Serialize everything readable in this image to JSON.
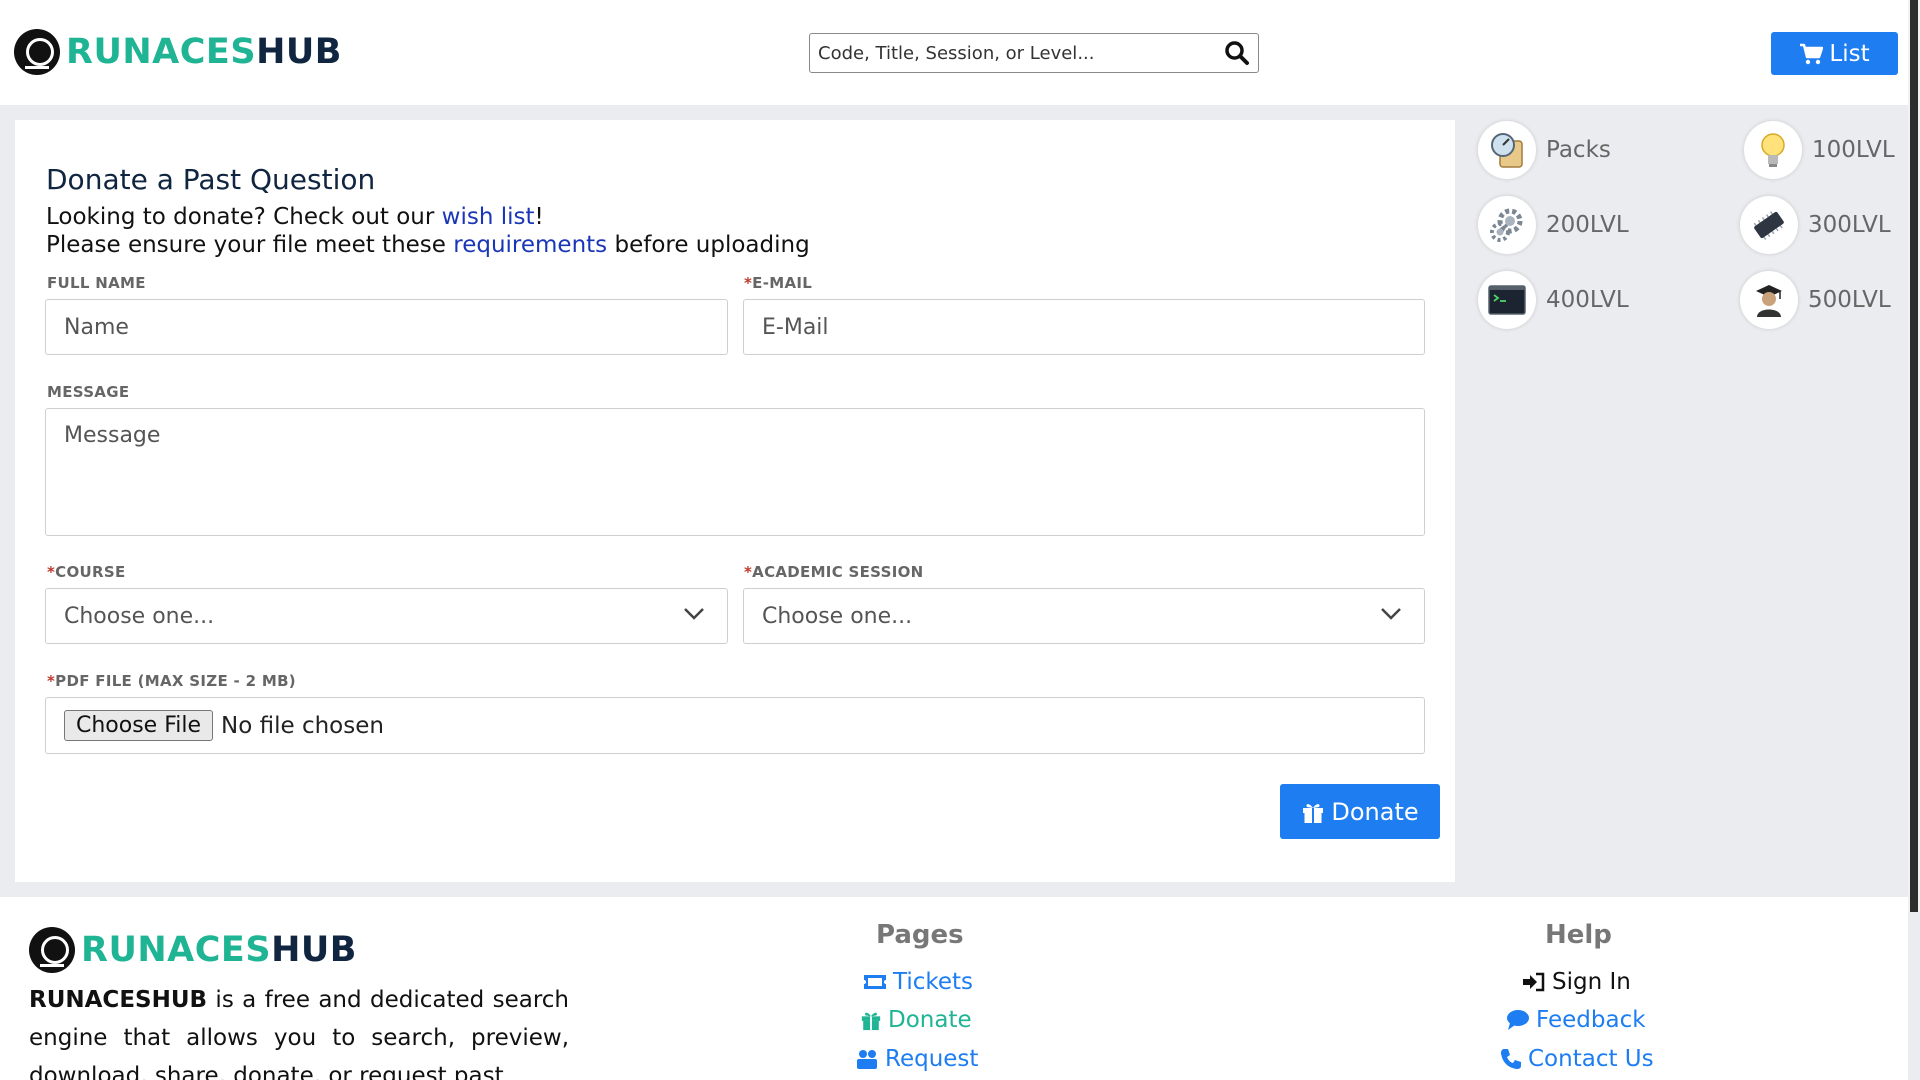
{
  "brand": {
    "part1": "RUNACES",
    "part2": "HUB",
    "mark_text": "RUNACES"
  },
  "header": {
    "search_placeholder": "Code, Title, Session, or Level...",
    "list_label": "List"
  },
  "form": {
    "title": "Donate a Past Question",
    "intro_prefix": "Looking to donate? Check out our ",
    "wishlist_link": "wish list",
    "intro_suffix": "!",
    "ensure_prefix": "Please ensure your file meet these ",
    "requirements_link": "requirements",
    "ensure_suffix": " before uploading",
    "full_name_label": "FULL NAME",
    "full_name_placeholder": "Name",
    "email_required": "*",
    "email_label": "E-MAIL",
    "email_placeholder": "E-Mail",
    "message_label": "MESSAGE",
    "message_placeholder": "Message",
    "course_required": "*",
    "course_label": "COURSE",
    "course_value": "Choose one...",
    "session_required": "*",
    "session_label": "ACADEMIC SESSION",
    "session_value": "Choose one...",
    "pdf_required": "*",
    "pdf_label": "PDF FILE (MAX SIZE - 2 MB)",
    "file_button": "Choose File",
    "file_status": "No file chosen",
    "donate_button": "Donate"
  },
  "sidebar": {
    "items": [
      {
        "label": "Packs",
        "icon": "compass-scroll-icon"
      },
      {
        "label": "100LVL",
        "icon": "lightbulb-icon"
      },
      {
        "label": "200LVL",
        "icon": "gears-icon"
      },
      {
        "label": "300LVL",
        "icon": "chip-icon"
      },
      {
        "label": "400LVL",
        "icon": "terminal-icon"
      },
      {
        "label": "500LVL",
        "icon": "graduate-icon"
      }
    ]
  },
  "footer": {
    "brand_bold": "RUNACESHUB",
    "description": " is a free and dedicated search engine that allows you to search, preview, download, share, donate, or request past",
    "pages_title": "Pages",
    "pages": [
      "Tickets",
      "Donate",
      "Request"
    ],
    "help_title": "Help",
    "help": [
      "Sign In",
      "Feedback",
      "Contact Us"
    ]
  },
  "colors": {
    "accent": "#1d7df1",
    "brand_teal": "#1fb494",
    "brand_navy": "#0f2540"
  }
}
